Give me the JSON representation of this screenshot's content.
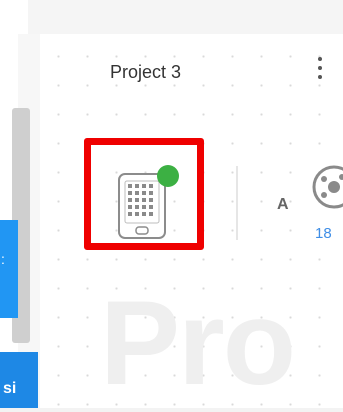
{
  "project": {
    "title": "Project 3",
    "watermark": "Pro"
  },
  "device": {
    "status_color": "#3cb043"
  },
  "secondary": {
    "label": "A",
    "count": "18"
  },
  "sidebar": {
    "blue_text_1": ":",
    "blue_text_2": "si"
  },
  "colors": {
    "highlight": "#ef0000",
    "accent": "#3f8ee6"
  }
}
